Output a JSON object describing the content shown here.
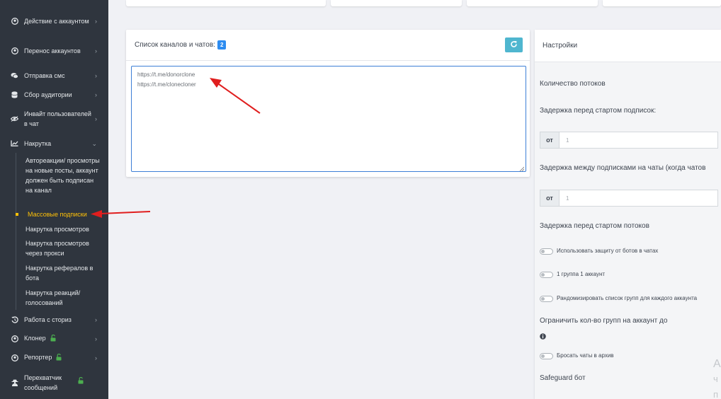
{
  "sidebar": {
    "items": [
      {
        "label": "Действие с аккаунтом",
        "icon": "user-circle-icon"
      },
      {
        "label": "Перенос аккаунтов",
        "icon": "user-circle-icon"
      },
      {
        "label": "Отправка смс",
        "icon": "chat-icon"
      },
      {
        "label": "Сбор аудитории",
        "icon": "database-icon"
      },
      {
        "label": "Инвайт пользователей в чат",
        "icon": "eye-icon"
      },
      {
        "label": "Накрутка",
        "icon": "chart-icon"
      },
      {
        "label": "Работа с сториз",
        "icon": "history-icon"
      },
      {
        "label": "Клонер",
        "icon": "user-circle-icon"
      },
      {
        "label": "Репортер",
        "icon": "user-circle-icon"
      },
      {
        "label": "Перехватчик сообщений",
        "icon": "user-secret-icon"
      }
    ],
    "subitems": [
      {
        "label": "Автореакции/ просмотры на новые посты, аккаунт должен быть подписан на канал"
      },
      {
        "label": "Массовые подписки"
      },
      {
        "label": "Накрутка просмотров"
      },
      {
        "label": "Накрутка просмотров через прокси"
      },
      {
        "label": "Накрутка рефералов в бота"
      },
      {
        "label": "Накрутка реакций/ голосований"
      }
    ],
    "active_color": "#ffc107",
    "lock_color": "#4caf50"
  },
  "channels": {
    "title": "Список каналов и чатов:",
    "count": "2",
    "links": [
      "https://t.me/donorclone",
      "https://t.me/clonecloner"
    ]
  },
  "settings": {
    "title": "Настройки",
    "threads_label": "Количество потоков",
    "delay_start_label": "Задержка перед стартом подписок:",
    "from_label": "от",
    "delay_start_from": "1",
    "delay_between_label": "Задержка между подписками на чаты (когда чатов",
    "delay_between_from": "1",
    "delay_threads_label": "Задержка перед стартом потоков",
    "toggle_bot_protection": "Использовать защиту от ботов в чатах",
    "toggle_one_group": "1 группа 1 аккаунт",
    "toggle_randomize": "Рандомизировать список групп для каждого аккаунта",
    "limit_groups_label": "Ограничить кол-во групп на аккаунт до",
    "toggle_archive": "Бросать чаты в архив",
    "safeguard_label": "Safeguard бот",
    "ghost_1": "A",
    "ghost_2": "ч",
    "ghost_3": "п"
  },
  "colors": {
    "sidebar_bg": "#2f353e",
    "primary": "#2d8cf0",
    "refresh": "#4fb6cf",
    "arrow": "#e01e1e"
  }
}
